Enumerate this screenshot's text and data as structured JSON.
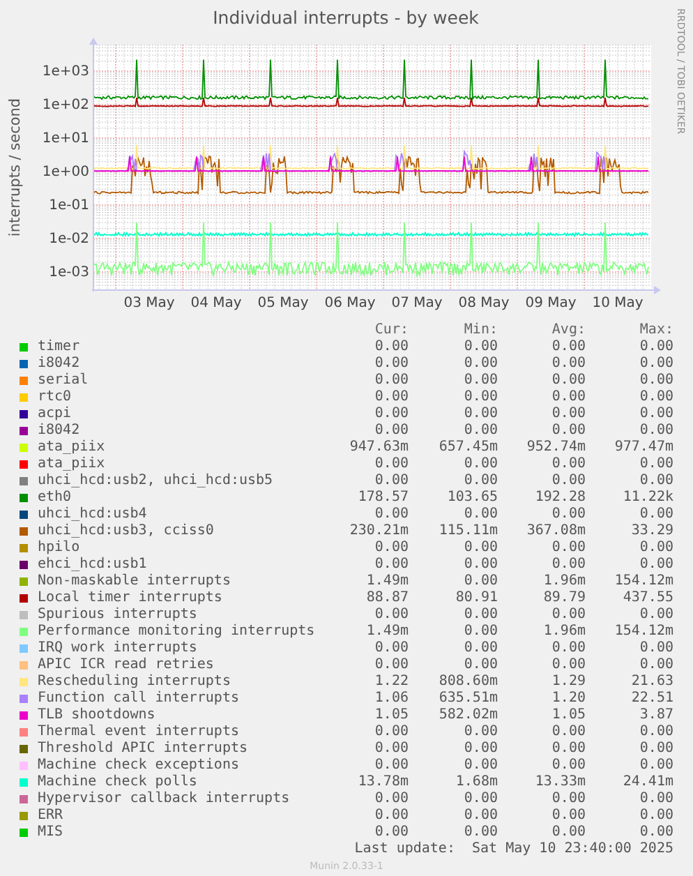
{
  "chart": {
    "title": "Individual interrupts - by week",
    "y_axis_label": "interrupts / second",
    "side_text": "RRDTOOL / TOBI OETIKER",
    "y_ticks": [
      "1e+03",
      "1e+02",
      "1e+01",
      "1e+00",
      "1e-01",
      "1e-02",
      "1e-03"
    ],
    "x_ticks": [
      "03 May",
      "04 May",
      "05 May",
      "06 May",
      "07 May",
      "08 May",
      "09 May",
      "10 May"
    ]
  },
  "legend": {
    "columns": [
      "Cur:",
      "Min:",
      "Avg:",
      "Max:"
    ],
    "rows": [
      {
        "name": "timer",
        "color": "#00cc00",
        "cur": "0.00",
        "min": "0.00",
        "avg": "0.00",
        "max": "0.00"
      },
      {
        "name": "i8042",
        "color": "#0066b3",
        "cur": "0.00",
        "min": "0.00",
        "avg": "0.00",
        "max": "0.00"
      },
      {
        "name": "serial",
        "color": "#ff8000",
        "cur": "0.00",
        "min": "0.00",
        "avg": "0.00",
        "max": "0.00"
      },
      {
        "name": "rtc0",
        "color": "#ffcc00",
        "cur": "0.00",
        "min": "0.00",
        "avg": "0.00",
        "max": "0.00"
      },
      {
        "name": "acpi",
        "color": "#330099",
        "cur": "0.00",
        "min": "0.00",
        "avg": "0.00",
        "max": "0.00"
      },
      {
        "name": "i8042",
        "color": "#990099",
        "cur": "0.00",
        "min": "0.00",
        "avg": "0.00",
        "max": "0.00"
      },
      {
        "name": "ata_piix",
        "color": "#ccff00",
        "cur": "947.63m",
        "min": "657.45m",
        "avg": "952.74m",
        "max": "977.47m"
      },
      {
        "name": "ata_piix",
        "color": "#ff0000",
        "cur": "0.00",
        "min": "0.00",
        "avg": "0.00",
        "max": "0.00"
      },
      {
        "name": "uhci_hcd:usb2, uhci_hcd:usb5",
        "color": "#808080",
        "cur": "0.00",
        "min": "0.00",
        "avg": "0.00",
        "max": "0.00"
      },
      {
        "name": "eth0",
        "color": "#008f00",
        "cur": "178.57",
        "min": "103.65",
        "avg": "192.28",
        "max": "11.22k"
      },
      {
        "name": "uhci_hcd:usb4",
        "color": "#00487d",
        "cur": "0.00",
        "min": "0.00",
        "avg": "0.00",
        "max": "0.00"
      },
      {
        "name": "uhci_hcd:usb3, cciss0",
        "color": "#b35a00",
        "cur": "230.21m",
        "min": "115.11m",
        "avg": "367.08m",
        "max": "33.29"
      },
      {
        "name": "hpilo",
        "color": "#b38f00",
        "cur": "0.00",
        "min": "0.00",
        "avg": "0.00",
        "max": "0.00"
      },
      {
        "name": "ehci_hcd:usb1",
        "color": "#6b006b",
        "cur": "0.00",
        "min": "0.00",
        "avg": "0.00",
        "max": "0.00"
      },
      {
        "name": "Non-maskable interrupts",
        "color": "#8fb300",
        "cur": "1.49m",
        "min": "0.00",
        "avg": "1.96m",
        "max": "154.12m"
      },
      {
        "name": "Local timer interrupts",
        "color": "#b30000",
        "cur": "88.87",
        "min": "80.91",
        "avg": "89.79",
        "max": "437.55"
      },
      {
        "name": "Spurious interrupts",
        "color": "#bebebe",
        "cur": "0.00",
        "min": "0.00",
        "avg": "0.00",
        "max": "0.00"
      },
      {
        "name": "Performance monitoring interrupts",
        "color": "#80ff80",
        "cur": "1.49m",
        "min": "0.00",
        "avg": "1.96m",
        "max": "154.12m"
      },
      {
        "name": "IRQ work interrupts",
        "color": "#80c9ff",
        "cur": "0.00",
        "min": "0.00",
        "avg": "0.00",
        "max": "0.00"
      },
      {
        "name": "APIC ICR read retries",
        "color": "#ffc080",
        "cur": "0.00",
        "min": "0.00",
        "avg": "0.00",
        "max": "0.00"
      },
      {
        "name": "Rescheduling interrupts",
        "color": "#ffe680",
        "cur": "1.22",
        "min": "808.60m",
        "avg": "1.29",
        "max": "21.63"
      },
      {
        "name": "Function call interrupts",
        "color": "#aa80ff",
        "cur": "1.06",
        "min": "635.51m",
        "avg": "1.20",
        "max": "22.51"
      },
      {
        "name": "TLB shootdowns",
        "color": "#ee00cc",
        "cur": "1.05",
        "min": "582.02m",
        "avg": "1.05",
        "max": "3.87"
      },
      {
        "name": "Thermal event interrupts",
        "color": "#ff8080",
        "cur": "0.00",
        "min": "0.00",
        "avg": "0.00",
        "max": "0.00"
      },
      {
        "name": "Threshold APIC interrupts",
        "color": "#666600",
        "cur": "0.00",
        "min": "0.00",
        "avg": "0.00",
        "max": "0.00"
      },
      {
        "name": "Machine check exceptions",
        "color": "#ffbfff",
        "cur": "0.00",
        "min": "0.00",
        "avg": "0.00",
        "max": "0.00"
      },
      {
        "name": "Machine check polls",
        "color": "#00ffcc",
        "cur": "13.78m",
        "min": "1.68m",
        "avg": "13.33m",
        "max": "24.41m"
      },
      {
        "name": "Hypervisor callback interrupts",
        "color": "#cc6699",
        "cur": "0.00",
        "min": "0.00",
        "avg": "0.00",
        "max": "0.00"
      },
      {
        "name": "ERR",
        "color": "#999900",
        "cur": "0.00",
        "min": "0.00",
        "avg": "0.00",
        "max": "0.00"
      },
      {
        "name": "MIS",
        "color": "#00cc00",
        "cur": "0.00",
        "min": "0.00",
        "avg": "0.00",
        "max": "0.00"
      }
    ]
  },
  "last_update": "Last update:  Sat May 10 23:40:00 2025",
  "footer": "Munin 2.0.33-1"
}
